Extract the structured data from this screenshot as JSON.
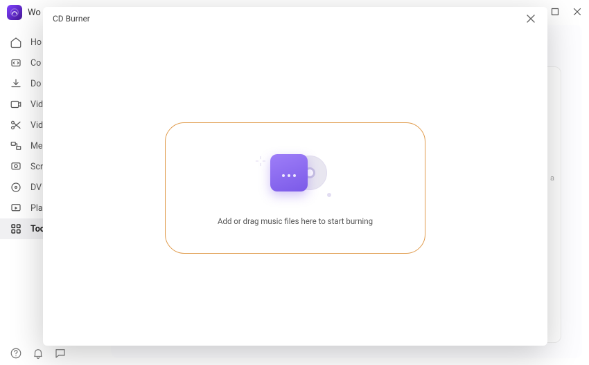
{
  "app": {
    "title": "Wo"
  },
  "window_controls": {
    "minimize": "minimize",
    "maximize": "maximize",
    "close": "close"
  },
  "sidebar": {
    "items": [
      {
        "icon": "home-icon",
        "label": "Ho"
      },
      {
        "icon": "convert-icon",
        "label": "Co"
      },
      {
        "icon": "download-icon",
        "label": "Do"
      },
      {
        "icon": "video-icon",
        "label": "Vid"
      },
      {
        "icon": "scissors-icon",
        "label": "Vid"
      },
      {
        "icon": "merge-icon",
        "label": "Me"
      },
      {
        "icon": "record-icon",
        "label": "Scr"
      },
      {
        "icon": "disc-icon",
        "label": "DV"
      },
      {
        "icon": "play-icon",
        "label": "Pla"
      },
      {
        "icon": "grid-icon",
        "label": "Too"
      }
    ],
    "active_index": 9,
    "bottom_icons": [
      "help-icon",
      "bell-icon",
      "chat-icon"
    ]
  },
  "background": {
    "stub_text": "a"
  },
  "modal": {
    "title": "CD Burner",
    "dropzone_text": "Add or drag music files here to start burning"
  }
}
